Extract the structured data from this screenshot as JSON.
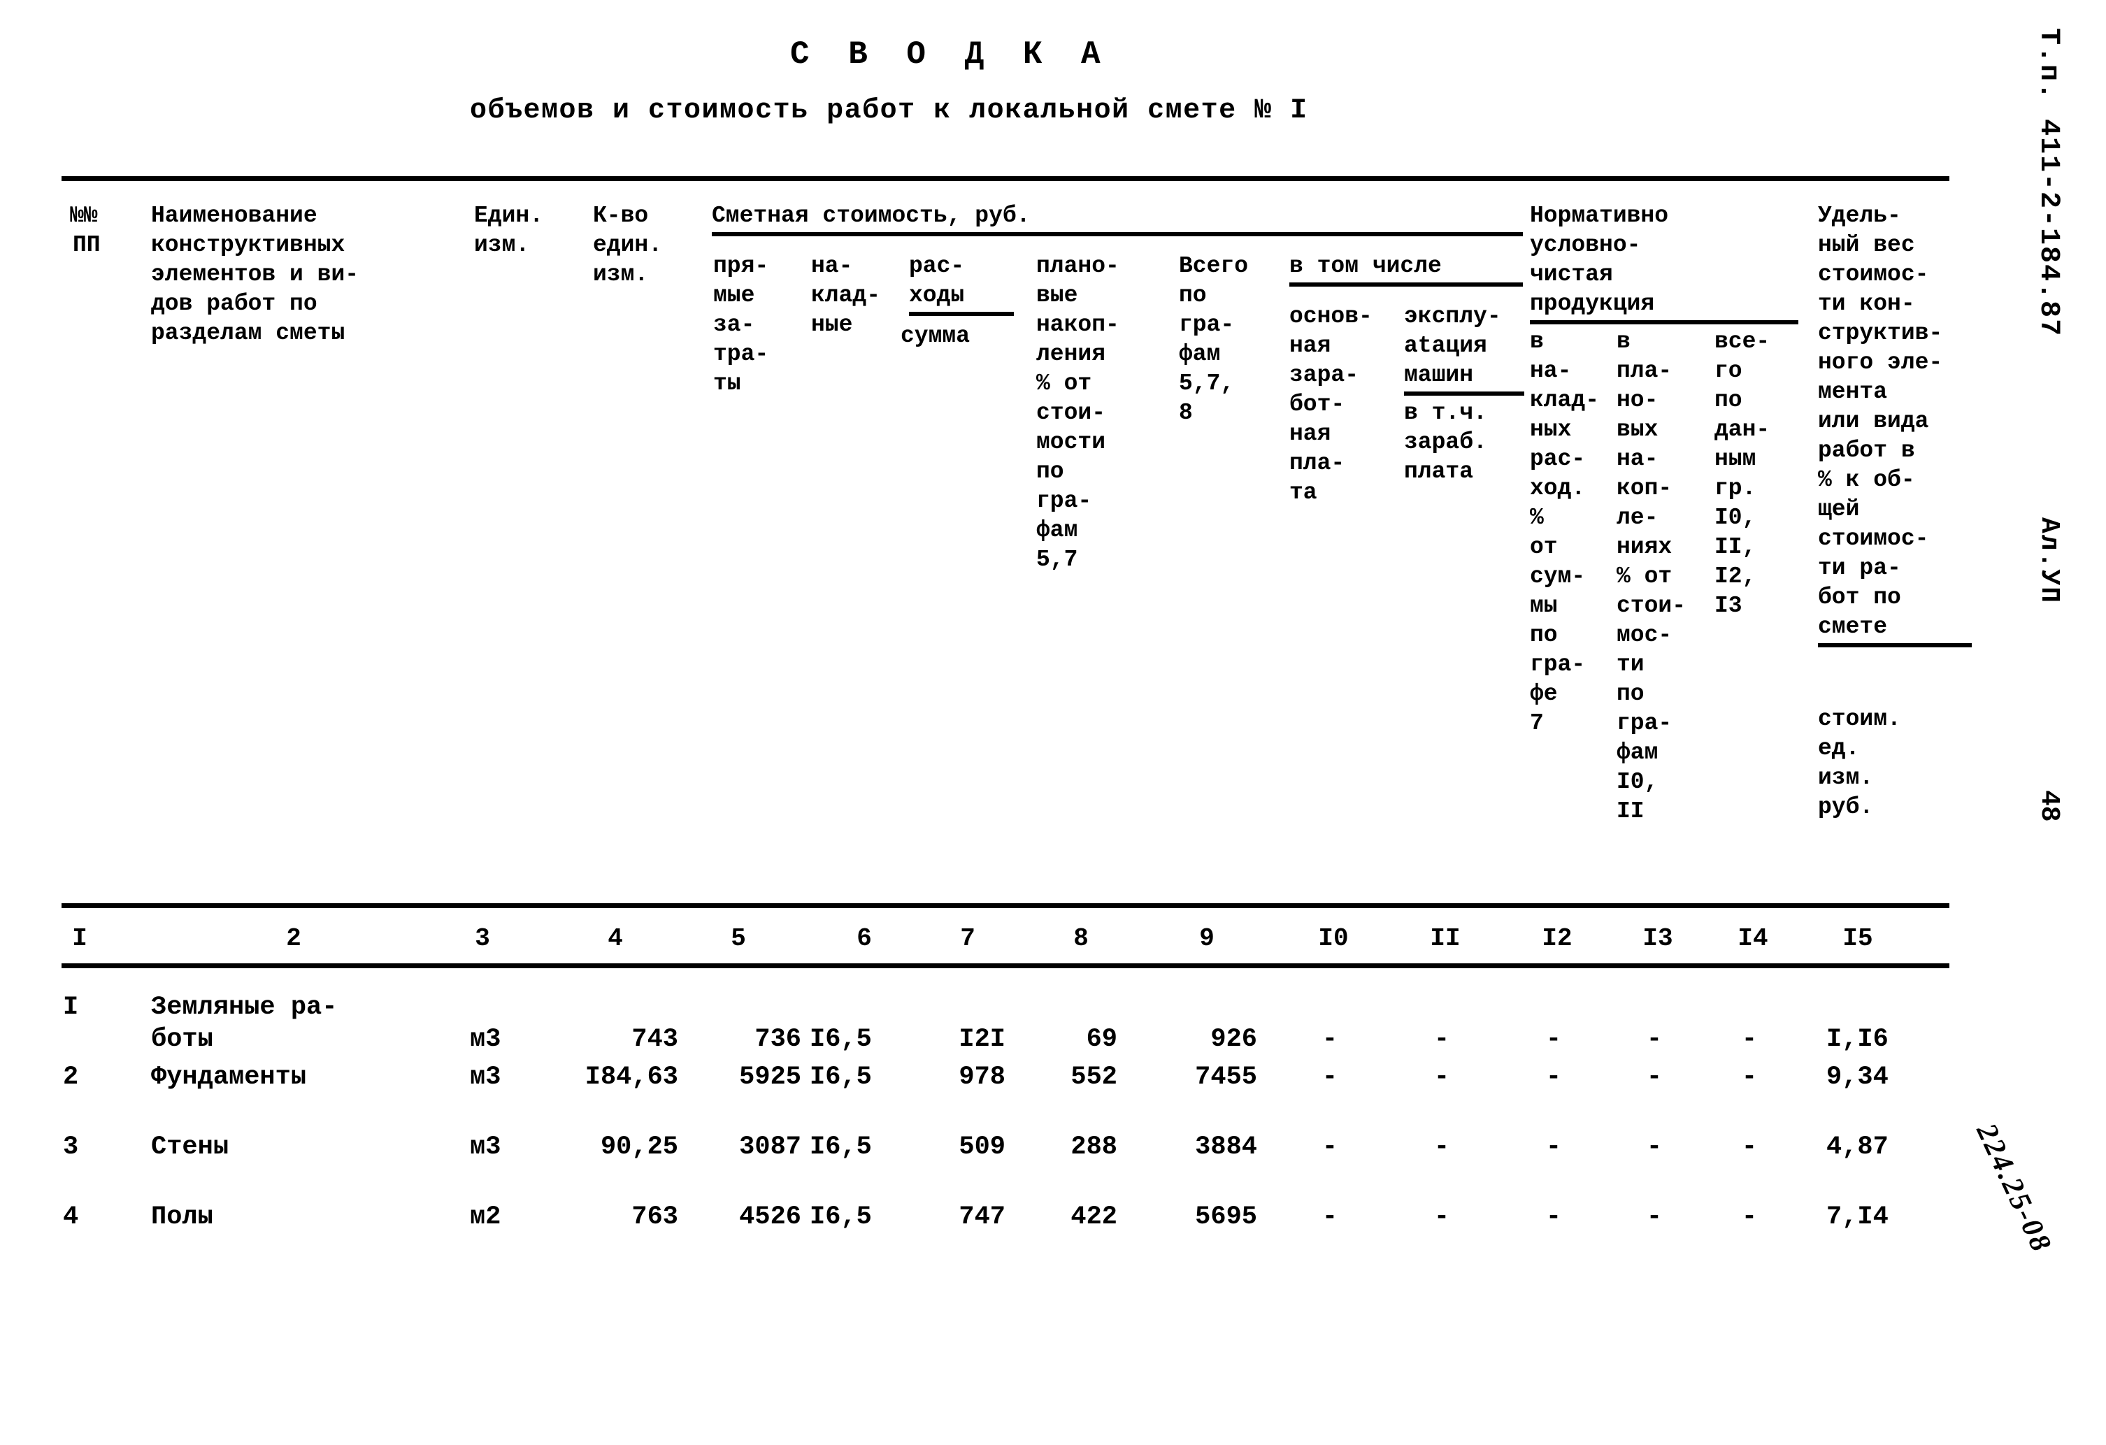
{
  "document": {
    "title": "С В О Д К А",
    "subtitle": "объемов и стоимость работ к локальной смете № I"
  },
  "margin": {
    "code": "Т.п. 411-2-184.87",
    "album": "Ал.УП",
    "page": "48",
    "stamp": "224.25-08"
  },
  "header": {
    "col1_line1": "№№",
    "col1_line2": "ПП",
    "col2": "Наименование\nконструктивных\nэлементов и ви-\nдов работ по\nразделам сметы",
    "col3": "Един.\nизм.",
    "col4": "К-во\nедин.\nизм.",
    "group_smeta": "Сметная стоимость, руб.",
    "col5": "пря-\nмые\nза-\nтра-\nты",
    "col6": "на-\nклад-\nные",
    "col7_head": "рас-\nходы",
    "col7_sum": "сумма",
    "col8": "плано-\nвые\nнакоп-\nления\n% от\nстои-\nмости\nпо\nгра-\nфам\n5,7",
    "col9": "Всего\nпо\nгра-\nфам\n5,7,\n8",
    "group_vtomchisle": "в том числе",
    "col10": "основ-\nная\nзара-\nбот-\nная\nпла-\nта",
    "col11_head": "эксплу-\natация\nмашин",
    "col11_sub": "в т.ч.\nзараб.\nплата",
    "group_nchp": "Нормативно\nусловно-\nчистая\nпродукция",
    "col12": "в\nна-\nклад-\nных\nрас-\nход.\n%\nот\nсум-\nмы\nпо\nгра-\nфе\n7",
    "col13": "в\nпла-\nно-\nвых\nна-\nкоп-\nле-\nниях\n% от\nстои-\nмос-\nти\nпо\nгра-\nфам\nI0,\nII",
    "col14": "все-\nго\nпо\nдан-\nным\nгр.\nI0,\nII,\nI2,\nI3",
    "col15_head": "Удель-\nный вес\nстоимос-\nти кон-\nструктив-\nного эле-\nмента\nили вида\nработ в\n% к об-\nщей\nстоимос-\nти ра-\nбот по\nсмете",
    "col15_sub": "стоим.\nед.\nизм.\nруб."
  },
  "column_numbers": [
    "I",
    "2",
    "3",
    "4",
    "5",
    "6",
    "7",
    "8",
    "9",
    "I0",
    "II",
    "I2",
    "I3",
    "I4",
    "I5"
  ],
  "rows": [
    {
      "no": "I",
      "name": "Земляные ра-\nботы",
      "unit": "м3",
      "qty": "743",
      "direct": "736",
      "overhead": "I6,5",
      "expenses": "I2I",
      "profit": "69",
      "total": "926",
      "wages": "-",
      "machines": "-",
      "nchp_overhead": "-",
      "nchp_profit": "-",
      "nchp_total": "-",
      "share": "I,I6"
    },
    {
      "no": "2",
      "name": "Фундаменты",
      "unit": "м3",
      "qty": "I84,63",
      "direct": "5925",
      "overhead": "I6,5",
      "expenses": "978",
      "profit": "552",
      "total": "7455",
      "wages": "-",
      "machines": "-",
      "nchp_overhead": "-",
      "nchp_profit": "-",
      "nchp_total": "-",
      "share": "9,34"
    },
    {
      "no": "3",
      "name": "Стены",
      "unit": "м3",
      "qty": "90,25",
      "direct": "3087",
      "overhead": "I6,5",
      "expenses": "509",
      "profit": "288",
      "total": "3884",
      "wages": "-",
      "machines": "-",
      "nchp_overhead": "-",
      "nchp_profit": "-",
      "nchp_total": "-",
      "share": "4,87"
    },
    {
      "no": "4",
      "name": "Полы",
      "unit": "м2",
      "qty": "763",
      "direct": "4526",
      "overhead": "I6,5",
      "expenses": "747",
      "profit": "422",
      "total": "5695",
      "wages": "-",
      "machines": "-",
      "nchp_overhead": "-",
      "nchp_profit": "-",
      "nchp_total": "-",
      "share": "7,I4"
    }
  ]
}
